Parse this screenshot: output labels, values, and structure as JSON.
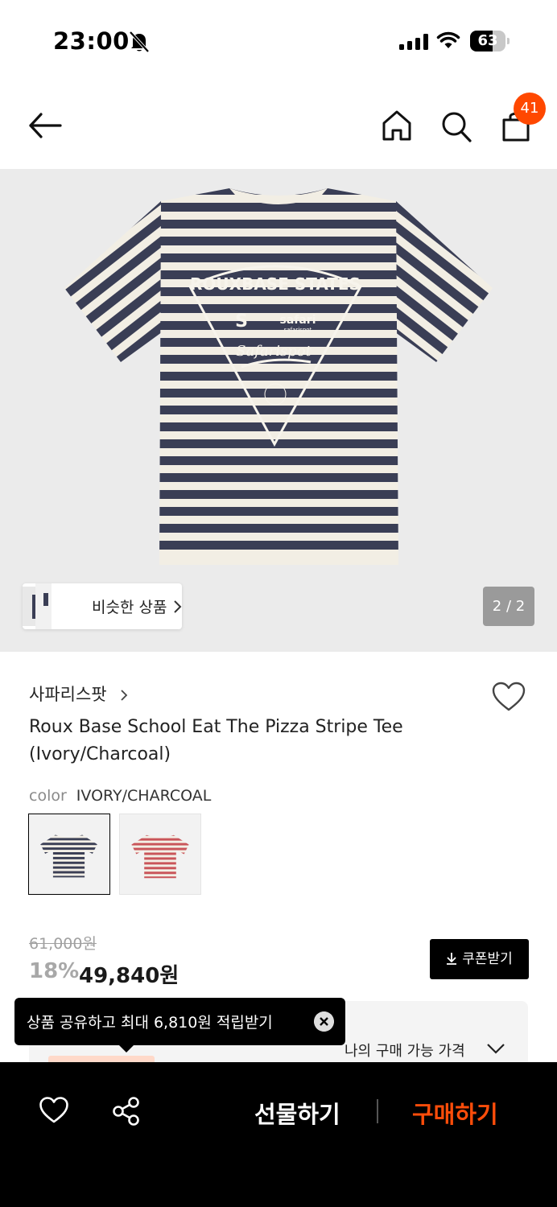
{
  "status_bar": {
    "time": "23:00",
    "battery": "63",
    "battery_level": 0.63
  },
  "nav": {
    "cart_count": "41"
  },
  "gallery": {
    "similar_label": "비슷한 상품",
    "page_counter": "2 / 2",
    "graphic_text": [
      "ROUXBASE STATES",
      "safari",
      "safarispot",
      "Safarispot"
    ]
  },
  "product": {
    "brand": "사파리스팟",
    "title": "Roux Base School Eat The Pizza Stripe Tee (Ivory/Charcoal)",
    "color_key": "color",
    "color_value": "IVORY/CHARCOAL",
    "swatches": [
      {
        "name": "ivory-charcoal",
        "stripe": "#3b3f55",
        "base": "#f3efe6"
      },
      {
        "name": "ivory-red",
        "stripe": "#c9555a",
        "base": "#f3efe6"
      }
    ]
  },
  "pricing": {
    "original": "61,000원",
    "discount": "18%",
    "sale": "49,840원",
    "coupon_label": "쿠폰받기",
    "my_price_label": "나의 구매 가능 가격"
  },
  "tooltip": {
    "text": "상품 공유하고 최대 6,810원 적립받기"
  },
  "bottom_bar": {
    "gift_label": "선물하기",
    "buy_label": "구매하기"
  },
  "colors": {
    "accent": "#ff4d0a",
    "badge": "#ff4800",
    "hero_bg": "#ebebeb"
  }
}
